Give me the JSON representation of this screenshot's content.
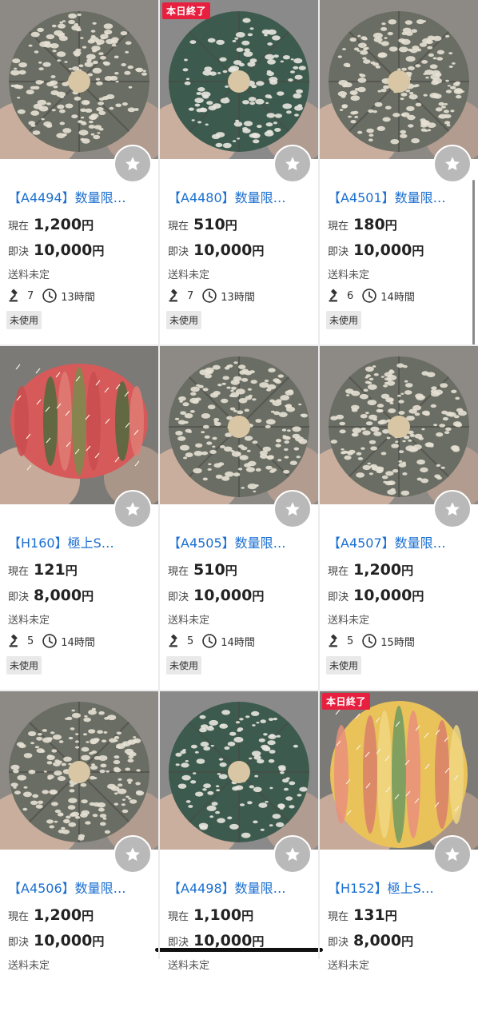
{
  "labels": {
    "current": "現在",
    "buyout": "即決",
    "yen": "円"
  },
  "colors": {
    "title_link": "#1a6fd1",
    "badge": "#e8203f",
    "fav_button": "#b9b9b9"
  },
  "items": [
    {
      "title": "【A4494】数量限…",
      "badge": "",
      "current": "1,200",
      "buyout": "10,000",
      "shipping": "送料未定",
      "bids": "7",
      "time_left": "13時間",
      "condition": "未使用",
      "plant": "astro-white"
    },
    {
      "title": "【A4480】数量限…",
      "badge": "本日終了",
      "current": "510",
      "buyout": "10,000",
      "shipping": "送料未定",
      "bids": "7",
      "time_left": "13時間",
      "condition": "未使用",
      "plant": "astro-green"
    },
    {
      "title": "【A4501】数量限…",
      "badge": "",
      "current": "180",
      "buyout": "10,000",
      "shipping": "送料未定",
      "bids": "6",
      "time_left": "14時間",
      "condition": "未使用",
      "plant": "astro-white"
    },
    {
      "title": "【H160】極上S…",
      "badge": "",
      "current": "121",
      "buyout": "8,000",
      "shipping": "送料未定",
      "bids": "5",
      "time_left": "14時間",
      "condition": "未使用",
      "plant": "gymno-red"
    },
    {
      "title": "【A4505】数量限…",
      "badge": "",
      "current": "510",
      "buyout": "10,000",
      "shipping": "送料未定",
      "bids": "5",
      "time_left": "14時間",
      "condition": "未使用",
      "plant": "astro-white"
    },
    {
      "title": "【A4507】数量限…",
      "badge": "",
      "current": "1,200",
      "buyout": "10,000",
      "shipping": "送料未定",
      "bids": "5",
      "time_left": "15時間",
      "condition": "未使用",
      "plant": "astro-white"
    },
    {
      "title": "【A4506】数量限…",
      "badge": "",
      "current": "1,200",
      "buyout": "10,000",
      "shipping": "送料未定",
      "bids": "",
      "time_left": "",
      "condition": "",
      "plant": "astro-white"
    },
    {
      "title": "【A4498】数量限…",
      "badge": "",
      "current": "1,100",
      "buyout": "10,000",
      "shipping": "送料未定",
      "bids": "",
      "time_left": "",
      "condition": "",
      "plant": "astro-green"
    },
    {
      "title": "【H152】極上S…",
      "badge": "本日終了",
      "current": "131",
      "buyout": "8,000",
      "shipping": "送料未定",
      "bids": "",
      "time_left": "",
      "condition": "",
      "plant": "gymno-yellow"
    }
  ],
  "icons": {
    "favorite": "star-icon",
    "bids": "gavel-icon",
    "time": "clock-icon"
  }
}
